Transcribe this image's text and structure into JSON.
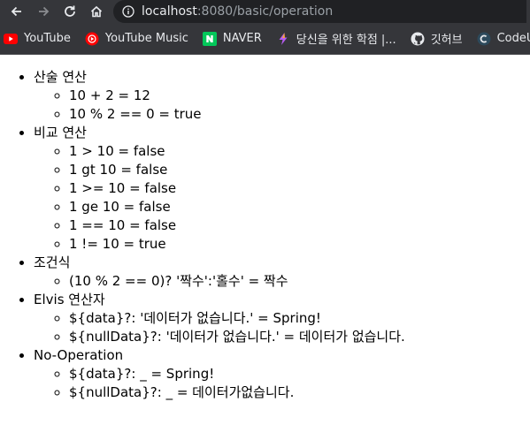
{
  "browser": {
    "url_host": "localhost",
    "url_rest": ":8080/basic/operation",
    "bookmarks": [
      {
        "label": "YouTube",
        "icon": "youtube-icon"
      },
      {
        "label": "YouTube Music",
        "icon": "youtube-music-icon"
      },
      {
        "label": "NAVER",
        "icon": "naver-icon"
      },
      {
        "label": "당신을 위한 학점 |...",
        "icon": "bookmark-site-icon"
      },
      {
        "label": "깃허브",
        "icon": "github-icon"
      },
      {
        "label": "CodeUp",
        "icon": "codeup-icon"
      }
    ]
  },
  "sections": [
    {
      "title": "산술 연산",
      "items": [
        "10 + 2 = 12",
        "10 % 2 == 0 = true"
      ]
    },
    {
      "title": "비교 연산",
      "items": [
        "1 > 10 = false",
        "1 gt 10 = false",
        "1 >= 10 = false",
        "1 ge 10 = false",
        "1 == 10 = false",
        "1 != 10 = true"
      ]
    },
    {
      "title": "조건식",
      "items": [
        "(10 % 2 == 0)? '짝수':'홀수' = 짝수"
      ]
    },
    {
      "title": "Elvis 연산자",
      "items": [
        "${data}?: '데이터가 없습니다.' = Spring!",
        "${nullData}?: '데이터가 없습니다.' = 데이터가 없습니다."
      ]
    },
    {
      "title": "No-Operation",
      "items": [
        "${data}?: _ = Spring!",
        "${nullData}?: _ = 데이터가없습니다."
      ]
    }
  ]
}
